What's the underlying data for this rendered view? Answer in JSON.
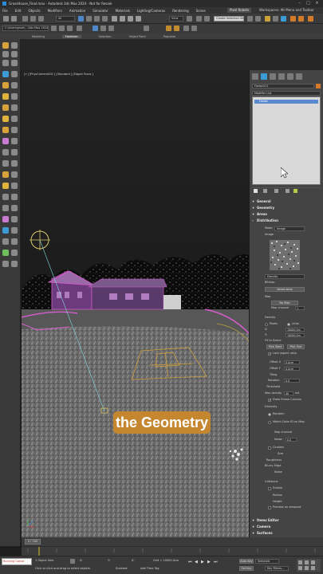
{
  "window": {
    "title": "GrassHouse_Final.max - Autodesk 3ds Max 2024 - Not for Resale"
  },
  "menu": [
    "File",
    "Edit",
    "Objects",
    "Modifiers",
    "Animation",
    "Simulator",
    "Materials",
    "Lighting/Cameras",
    "Rendering",
    "Scene"
  ],
  "menu_right": {
    "pixel_robots": "Pixel Robots",
    "workspace": "Workspaces:  Alt Menu and Toolbar"
  },
  "toolbar": {
    "filter": "All",
    "view": "View",
    "selection_set": "Create Selection Se"
  },
  "toolbar2": {
    "project": "C:\\Users\\pixel\\...\\3ds Max 2024"
  },
  "ribbon": {
    "tabs": [
      "Modeling",
      "Freeform",
      "Selection",
      "Object Paint",
      "Populate"
    ],
    "active": "Freeform"
  },
  "viewport": {
    "label": "[+] [PhysCamera002 ] [Standard ] [Edged Faces ]",
    "caption": "the Geometry"
  },
  "command_panel": {
    "object_name": "Forest011",
    "modifier_list": "Modifier List",
    "stack_item": "Forest",
    "rollouts_top": [
      "General",
      "Geometry",
      "Areas",
      "Distribution"
    ],
    "distribution": {
      "mode_label": "Mode",
      "mode_value": "Image",
      "image_label": "Image",
      "image_type": "Density",
      "bitmap_label": "Bitmap",
      "bitmap_value": "dense.bmp",
      "map_label": "Map",
      "no_map": "No Map",
      "map_channel": "Map channel",
      "density_label": "Density",
      "pixels": "Pixels",
      "units": "Units",
      "x_label": "X:",
      "y_label": "Y:",
      "x_value": "18000.0m",
      "y_value": "18000.0m",
      "fit_to_scene": "Fit to Scene",
      "pick_start": "Pick Start",
      "pick_end": "Pick End",
      "lock_aspect": "Lock aspect ratio",
      "offset_x": "Offset X",
      "offset_y": "Offset Y",
      "offset_x_val": "0.0cm",
      "offset_y_val": "0.0cm",
      "tiling": "Tiling",
      "rotation": "Rotation",
      "rotation_val": "0.0",
      "threshold": "Threshold",
      "max_density": "Max density",
      "max_density_val": "40",
      "max_density_unit": "mil.",
      "draw_frame": "Draw Frame Corners"
    },
    "diversity": {
      "label": "Diversity",
      "random": "Random",
      "match_color": "Match Color ID on Map",
      "map_channel": "Map channel",
      "noise": "Noise",
      "noise_val": "0.0",
      "clusters": "Clusters",
      "size": "Size",
      "roughness": "Roughness",
      "blurry_edge": "Blurry Edge",
      "noise2": "Noise"
    },
    "collisions": {
      "label": "Collisions",
      "enable": "Enable",
      "radius": "Radius",
      "height": "Height",
      "preview": "Preview on viewport"
    },
    "rollouts_bottom": [
      "Items Editor",
      "Camera",
      "Surfaces"
    ]
  },
  "timeline": {
    "frame": "0 / 100"
  },
  "status": {
    "listener": "Running Conse",
    "selected": "1 Object Sele",
    "hint": "Click or click-and-drag to select objects",
    "grid": "Grid = 10000.0cm",
    "enabled": "Enabled:",
    "add_time_tag": "Add Time Tag",
    "auto_key": "Auto Key",
    "set_key": "Set Key",
    "selected_dd": "Selected",
    "key_filters": "Key Filters..."
  },
  "colors": {
    "accent": "#2a8bd8",
    "caption_bg": "#c4862e",
    "spline": "#d85ccf",
    "highlight": "#5b8ad1"
  }
}
